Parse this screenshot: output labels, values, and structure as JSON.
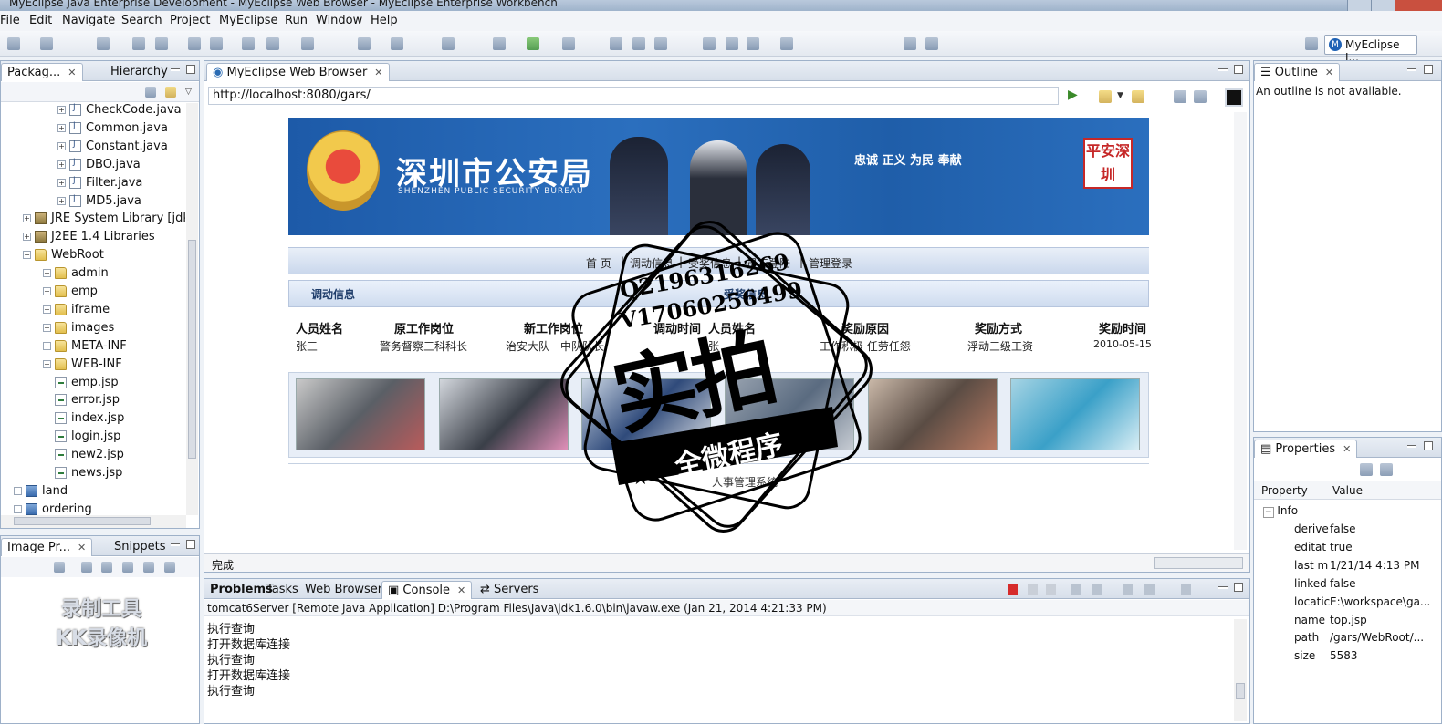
{
  "window": {
    "title": "MyEclipse Java Enterprise Development - MyEclipse Web Browser - MyEclipse Enterprise Workbench"
  },
  "menu": [
    "File",
    "Edit",
    "Navigate",
    "Search",
    "Project",
    "MyEclipse",
    "Run",
    "Window",
    "Help"
  ],
  "perspective": {
    "label": "MyEclipse J..."
  },
  "package_explorer": {
    "tab_label": "Packag...",
    "tab2_label": "Hierarchy",
    "items": [
      {
        "label": "CheckCode.java",
        "kind": "java",
        "indent": 3
      },
      {
        "label": "Common.java",
        "kind": "java",
        "indent": 3
      },
      {
        "label": "Constant.java",
        "kind": "java",
        "indent": 3
      },
      {
        "label": "DBO.java",
        "kind": "java",
        "indent": 3
      },
      {
        "label": "Filter.java",
        "kind": "java",
        "indent": 3
      },
      {
        "label": "MD5.java",
        "kind": "java",
        "indent": 3
      },
      {
        "label": "JRE System Library [jdk1",
        "kind": "lib",
        "indent": 1
      },
      {
        "label": "J2EE 1.4 Libraries",
        "kind": "lib",
        "indent": 1
      },
      {
        "label": "WebRoot",
        "kind": "folder",
        "indent": 1
      },
      {
        "label": "admin",
        "kind": "folder",
        "indent": 2
      },
      {
        "label": "emp",
        "kind": "folder",
        "indent": 2
      },
      {
        "label": "iframe",
        "kind": "folder",
        "indent": 2
      },
      {
        "label": "images",
        "kind": "folder",
        "indent": 2
      },
      {
        "label": "META-INF",
        "kind": "folder",
        "indent": 2
      },
      {
        "label": "WEB-INF",
        "kind": "folder",
        "indent": 2
      },
      {
        "label": "emp.jsp",
        "kind": "jsp",
        "indent": 2
      },
      {
        "label": "error.jsp",
        "kind": "jsp",
        "indent": 2
      },
      {
        "label": "index.jsp",
        "kind": "jsp",
        "indent": 2
      },
      {
        "label": "login.jsp",
        "kind": "jsp",
        "indent": 2
      },
      {
        "label": "new2.jsp",
        "kind": "jsp",
        "indent": 2
      },
      {
        "label": "news.jsp",
        "kind": "jsp",
        "indent": 2
      },
      {
        "label": "land",
        "kind": "proj",
        "indent": 0
      },
      {
        "label": "ordering",
        "kind": "proj",
        "indent": 0
      }
    ]
  },
  "image_preview": {
    "tab_label": "Image Pr...",
    "tab2_label": "Snippets",
    "watermark_line1": "录制工具",
    "watermark_line2": "KK录像机"
  },
  "browser": {
    "tab_label": "MyEclipse Web Browser",
    "url": "http://localhost:8080/gars/",
    "status": "完成",
    "page": {
      "banner_title": "深圳市公安局",
      "banner_subtitle": "SHENZHEN PUBLIC SECURITY BUREAU",
      "banner_slogan": "忠诚 正义 为民 奉献",
      "banner_seal": "平安深圳",
      "nav": [
        "首 页",
        "调动信息",
        "受奖信息",
        "员工登陆",
        "管理登录"
      ],
      "nav_seps": [
        "|",
        "|",
        "|",
        "|"
      ],
      "section1": "调动信息",
      "section2": "受奖信息",
      "headers": [
        "人员姓名",
        "原工作岗位",
        "新工作岗位",
        "调动时间",
        "人员姓名",
        "奖励原因",
        "奖励方式",
        "奖励时间"
      ],
      "row": [
        "张三",
        "警务督察三科科长",
        "治安大队一中队队长",
        "",
        "张",
        "工作积极 任劳任怨",
        "浮动三级工资",
        "2010-05-15"
      ],
      "footer": "人事管理系统"
    }
  },
  "stamp": {
    "line1": "Q2196316269",
    "line2": "V17060256499",
    "big": "实拍",
    "ribbon": "全微程序"
  },
  "outline": {
    "tab_label": "Outline",
    "message": "An outline is not available."
  },
  "properties": {
    "tab_label": "Properties",
    "col_property": "Property",
    "col_value": "Value",
    "group": "Info",
    "rows": [
      {
        "k": "derive",
        "v": "false"
      },
      {
        "k": "editat",
        "v": "true"
      },
      {
        "k": "last m",
        "v": "1/21/14 4:13 PM"
      },
      {
        "k": "linked",
        "v": "false"
      },
      {
        "k": "locatic",
        "v": "E:\\workspace\\ga..."
      },
      {
        "k": "name",
        "v": "top.jsp"
      },
      {
        "k": "path",
        "v": "/gars/WebRoot/..."
      },
      {
        "k": "size",
        "v": "5583"
      }
    ]
  },
  "console": {
    "tabs": [
      "Problems",
      "Tasks",
      "Web Browser",
      "Console",
      "Servers"
    ],
    "header": "tomcat6Server [Remote Java Application] D:\\Program Files\\Java\\jdk1.6.0\\bin\\javaw.exe (Jan 21, 2014 4:21:33 PM)",
    "lines": [
      "执行查询",
      "打开数据库连接",
      "执行查询",
      "打开数据库连接",
      "执行查询"
    ]
  }
}
